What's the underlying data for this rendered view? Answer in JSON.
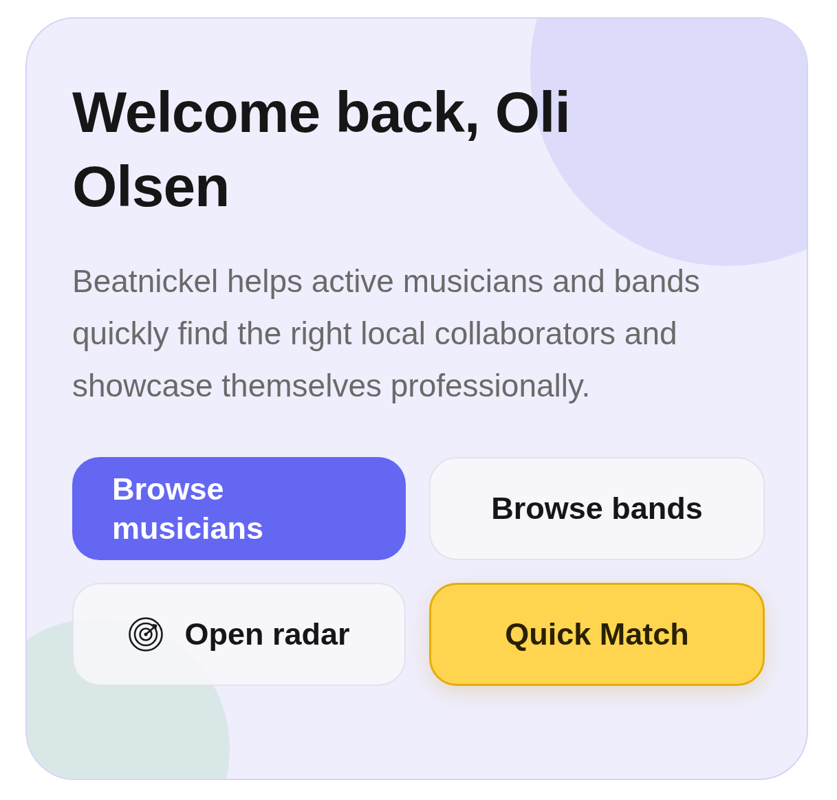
{
  "card": {
    "title": "Welcome back, Oli Olsen",
    "description": "Beatnickel helps active musicians and bands quickly find the right local collaborators and showcase themselves professionally.",
    "buttons": [
      {
        "label": "Browse musicians",
        "kind": "primary"
      },
      {
        "label": "Browse bands",
        "kind": "secondary"
      },
      {
        "label": "Open radar",
        "kind": "radar"
      },
      {
        "label": "Quick Match",
        "kind": "accent"
      }
    ]
  }
}
